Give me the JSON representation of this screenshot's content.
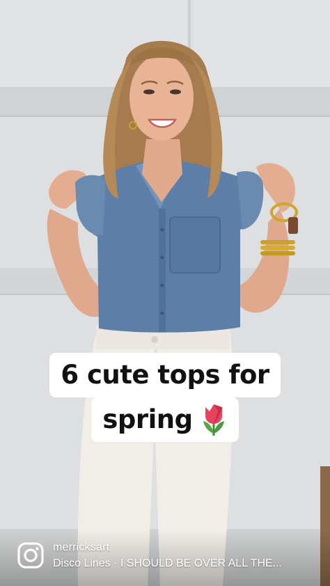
{
  "caption": {
    "line1": "6 cute tops for",
    "line2": "spring",
    "emoji_icon": "tulip-icon"
  },
  "footer": {
    "platform_icon": "instagram-icon",
    "username": "merricksart",
    "audio_track": "Disco Lines · I SHOULD BE OVER ALL THE..."
  },
  "colors": {
    "wall": "#dcdedf",
    "denim": "#5d7ea6",
    "pants": "#f1eee8",
    "caption_bg": "#ffffff",
    "caption_text": "#111111"
  }
}
